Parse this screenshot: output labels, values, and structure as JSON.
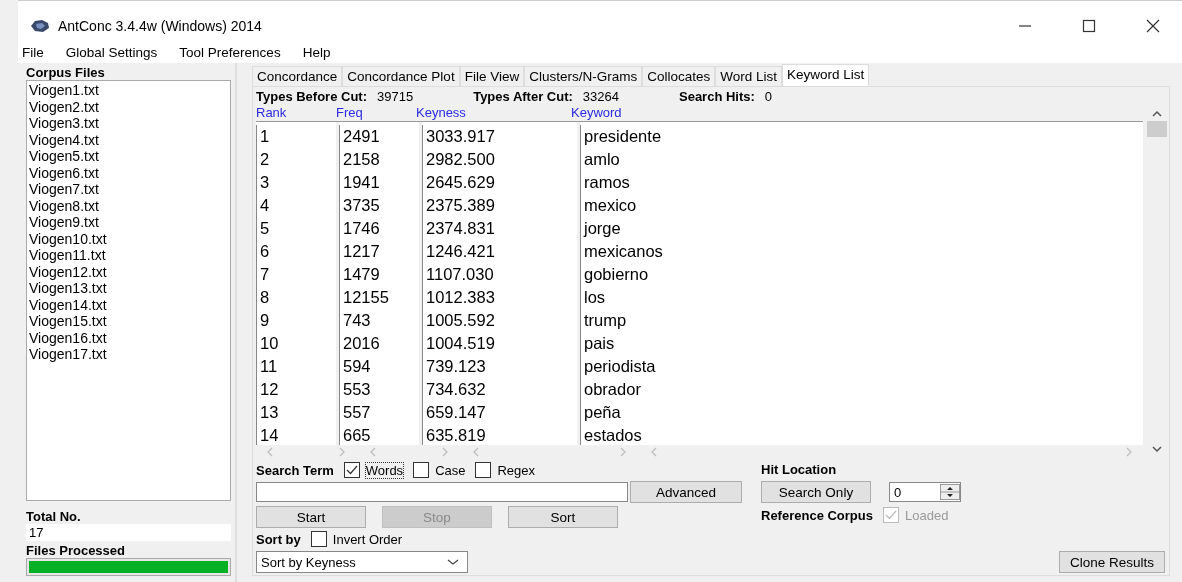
{
  "window": {
    "title": "AntConc 3.4.4w (Windows) 2014"
  },
  "menu": [
    "File",
    "Global Settings",
    "Tool Preferences",
    "Help"
  ],
  "corpus_files": {
    "label": "Corpus Files",
    "items": [
      "Viogen1.txt",
      "Viogen2.txt",
      "Viogen3.txt",
      "Viogen4.txt",
      "Viogen5.txt",
      "Viogen6.txt",
      "Viogen7.txt",
      "Viogen8.txt",
      "Viogen9.txt",
      "Viogen10.txt",
      "Viogen11.txt",
      "Viogen12.txt",
      "Viogen13.txt",
      "Viogen14.txt",
      "Viogen15.txt",
      "Viogen16.txt",
      "Viogen17.txt"
    ]
  },
  "total": {
    "label": "Total No.",
    "value": "17"
  },
  "files_processed": {
    "label": "Files Processed",
    "level": 1
  },
  "tabs": [
    {
      "label": "Concordance",
      "selected": false
    },
    {
      "label": "Concordance Plot",
      "selected": false
    },
    {
      "label": "File View",
      "selected": false
    },
    {
      "label": "Clusters/N-Grams",
      "selected": false
    },
    {
      "label": "Collocates",
      "selected": false
    },
    {
      "label": "Word List",
      "selected": false
    },
    {
      "label": "Keyword List",
      "selected": true
    }
  ],
  "stats": [
    {
      "label": "Types Before Cut:",
      "value": "39715"
    },
    {
      "label": "Types After Cut:",
      "value": "33264"
    },
    {
      "label": "Search Hits:",
      "value": "0"
    }
  ],
  "table": {
    "columns": [
      "Rank",
      "Freq",
      "Keyness",
      "Keyword"
    ],
    "rows": [
      [
        "1",
        "2491",
        "3033.917",
        "presidente"
      ],
      [
        "2",
        "2158",
        "2982.500",
        "amlo"
      ],
      [
        "3",
        "1941",
        "2645.629",
        "ramos"
      ],
      [
        "4",
        "3735",
        "2375.389",
        "mexico"
      ],
      [
        "5",
        "1746",
        "2374.831",
        "jorge"
      ],
      [
        "6",
        "1217",
        "1246.421",
        "mexicanos"
      ],
      [
        "7",
        "1479",
        "1107.030",
        "gobierno"
      ],
      [
        "8",
        "12155",
        "1012.383",
        "los"
      ],
      [
        "9",
        "743",
        "1005.592",
        "trump"
      ],
      [
        "10",
        "2016",
        "1004.519",
        "pais"
      ],
      [
        "11",
        "594",
        "739.123",
        "periodista"
      ],
      [
        "12",
        "553",
        "734.632",
        "obrador"
      ],
      [
        "13",
        "557",
        "659.147",
        "peña"
      ],
      [
        "14",
        "665",
        "635.819",
        "estados"
      ]
    ]
  },
  "search": {
    "label": "Search Term",
    "options": [
      {
        "label": "Words",
        "checked": true
      },
      {
        "label": "Case",
        "checked": false
      },
      {
        "label": "Regex",
        "checked": false
      }
    ],
    "advanced": "Advanced"
  },
  "actions": [
    {
      "label": "Start",
      "disabled": false
    },
    {
      "label": "Stop",
      "disabled": true
    },
    {
      "label": "Sort",
      "disabled": false
    }
  ],
  "sort": {
    "label": "Sort by",
    "invert": {
      "label": "Invert Order",
      "checked": false
    },
    "value": "Sort by Keyness"
  },
  "hit_location": {
    "label": "Hit Location",
    "button": "Search Only",
    "value": "0"
  },
  "reference": {
    "label": "Reference Corpus",
    "option": {
      "label": "Loaded",
      "checked": true,
      "disabled": true
    }
  },
  "clone": "Clone Results"
}
